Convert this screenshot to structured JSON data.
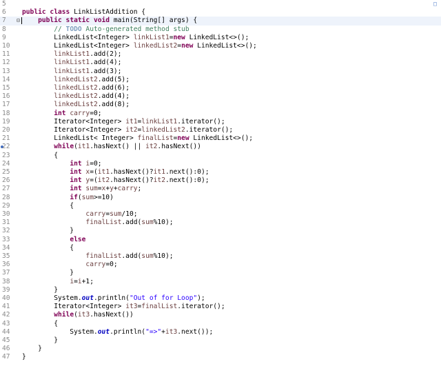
{
  "editor": {
    "lines": [
      {
        "n": "5",
        "marker": "",
        "tokens": []
      },
      {
        "n": "6",
        "marker": "",
        "tokens": [
          {
            "t": "kw",
            "v": "public class "
          },
          {
            "t": "",
            "v": "LinkListAddition {"
          }
        ]
      },
      {
        "n": "7",
        "marker": "fold",
        "tokens": [
          {
            "t": "",
            "v": "    "
          },
          {
            "t": "kw",
            "v": "public static void "
          },
          {
            "t": "",
            "v": "main(String[] args) {"
          }
        ]
      },
      {
        "n": "8",
        "marker": "",
        "tokens": [
          {
            "t": "",
            "v": "        "
          },
          {
            "t": "cm",
            "v": "// "
          },
          {
            "t": "todo",
            "v": "TODO"
          },
          {
            "t": "cm",
            "v": " Auto-generated method stub"
          }
        ]
      },
      {
        "n": "9",
        "marker": "",
        "tokens": [
          {
            "t": "",
            "v": "        LinkedList<Integer> "
          },
          {
            "t": "var",
            "v": "linkList1"
          },
          {
            "t": "",
            "v": "="
          },
          {
            "t": "kw",
            "v": "new "
          },
          {
            "t": "",
            "v": "LinkedList<>();"
          }
        ]
      },
      {
        "n": "10",
        "marker": "",
        "tokens": [
          {
            "t": "",
            "v": "        LinkedList<Integer> "
          },
          {
            "t": "var",
            "v": "linkedList2"
          },
          {
            "t": "",
            "v": "="
          },
          {
            "t": "kw",
            "v": "new "
          },
          {
            "t": "",
            "v": "LinkedList<>();"
          }
        ]
      },
      {
        "n": "11",
        "marker": "",
        "tokens": [
          {
            "t": "",
            "v": "        "
          },
          {
            "t": "var",
            "v": "linkList1"
          },
          {
            "t": "",
            "v": ".add(2);"
          }
        ]
      },
      {
        "n": "12",
        "marker": "",
        "tokens": [
          {
            "t": "",
            "v": "        "
          },
          {
            "t": "var",
            "v": "linkList1"
          },
          {
            "t": "",
            "v": ".add(4);"
          }
        ]
      },
      {
        "n": "13",
        "marker": "",
        "tokens": [
          {
            "t": "",
            "v": "        "
          },
          {
            "t": "var",
            "v": "linkList1"
          },
          {
            "t": "",
            "v": ".add(3);"
          }
        ]
      },
      {
        "n": "14",
        "marker": "",
        "tokens": [
          {
            "t": "",
            "v": "        "
          },
          {
            "t": "var",
            "v": "linkedList2"
          },
          {
            "t": "",
            "v": ".add(5);"
          }
        ]
      },
      {
        "n": "15",
        "marker": "",
        "tokens": [
          {
            "t": "",
            "v": "        "
          },
          {
            "t": "var",
            "v": "linkedList2"
          },
          {
            "t": "",
            "v": ".add(6);"
          }
        ]
      },
      {
        "n": "16",
        "marker": "",
        "tokens": [
          {
            "t": "",
            "v": "        "
          },
          {
            "t": "var",
            "v": "linkedList2"
          },
          {
            "t": "",
            "v": ".add(4);"
          }
        ]
      },
      {
        "n": "17",
        "marker": "",
        "tokens": [
          {
            "t": "",
            "v": "        "
          },
          {
            "t": "var",
            "v": "linkedList2"
          },
          {
            "t": "",
            "v": ".add(8);"
          }
        ]
      },
      {
        "n": "18",
        "marker": "",
        "tokens": [
          {
            "t": "",
            "v": "        "
          },
          {
            "t": "kw",
            "v": "int "
          },
          {
            "t": "var",
            "v": "carry"
          },
          {
            "t": "",
            "v": "=0;"
          }
        ]
      },
      {
        "n": "19",
        "marker": "",
        "tokens": [
          {
            "t": "",
            "v": "        Iterator<Integer> "
          },
          {
            "t": "var",
            "v": "it1"
          },
          {
            "t": "",
            "v": "="
          },
          {
            "t": "var",
            "v": "linkList1"
          },
          {
            "t": "",
            "v": ".iterator();"
          }
        ]
      },
      {
        "n": "20",
        "marker": "",
        "tokens": [
          {
            "t": "",
            "v": "        Iterator<Integer> "
          },
          {
            "t": "var",
            "v": "it2"
          },
          {
            "t": "",
            "v": "="
          },
          {
            "t": "var",
            "v": "linkedList2"
          },
          {
            "t": "",
            "v": ".iterator();"
          }
        ]
      },
      {
        "n": "21",
        "marker": "",
        "tokens": [
          {
            "t": "",
            "v": "        LinkedList< Integer> "
          },
          {
            "t": "var",
            "v": "finalList"
          },
          {
            "t": "",
            "v": "="
          },
          {
            "t": "kw",
            "v": "new "
          },
          {
            "t": "",
            "v": "LinkedList<>();"
          }
        ]
      },
      {
        "n": "22",
        "marker": "break",
        "tokens": [
          {
            "t": "",
            "v": "        "
          },
          {
            "t": "kw",
            "v": "while"
          },
          {
            "t": "",
            "v": "("
          },
          {
            "t": "var",
            "v": "it1"
          },
          {
            "t": "",
            "v": ".hasNext() || "
          },
          {
            "t": "var",
            "v": "it2"
          },
          {
            "t": "",
            "v": ".hasNext())"
          }
        ]
      },
      {
        "n": "23",
        "marker": "",
        "tokens": [
          {
            "t": "",
            "v": "        {"
          }
        ]
      },
      {
        "n": "24",
        "marker": "",
        "tokens": [
          {
            "t": "",
            "v": "            "
          },
          {
            "t": "kw",
            "v": "int "
          },
          {
            "t": "var",
            "v": "i"
          },
          {
            "t": "",
            "v": "=0;"
          }
        ]
      },
      {
        "n": "25",
        "marker": "",
        "tokens": [
          {
            "t": "",
            "v": "            "
          },
          {
            "t": "kw",
            "v": "int "
          },
          {
            "t": "var",
            "v": "x"
          },
          {
            "t": "",
            "v": "=("
          },
          {
            "t": "var",
            "v": "it1"
          },
          {
            "t": "",
            "v": ".hasNext()?"
          },
          {
            "t": "var",
            "v": "it1"
          },
          {
            "t": "",
            "v": ".next():0);"
          }
        ]
      },
      {
        "n": "26",
        "marker": "",
        "tokens": [
          {
            "t": "",
            "v": "            "
          },
          {
            "t": "kw",
            "v": "int "
          },
          {
            "t": "var",
            "v": "y"
          },
          {
            "t": "",
            "v": "=("
          },
          {
            "t": "var",
            "v": "it2"
          },
          {
            "t": "",
            "v": ".hasNext()?"
          },
          {
            "t": "var",
            "v": "it2"
          },
          {
            "t": "",
            "v": ".next():0);"
          }
        ]
      },
      {
        "n": "27",
        "marker": "",
        "tokens": [
          {
            "t": "",
            "v": "            "
          },
          {
            "t": "kw",
            "v": "int "
          },
          {
            "t": "var",
            "v": "sum"
          },
          {
            "t": "",
            "v": "="
          },
          {
            "t": "var",
            "v": "x"
          },
          {
            "t": "",
            "v": "+"
          },
          {
            "t": "var",
            "v": "y"
          },
          {
            "t": "",
            "v": "+"
          },
          {
            "t": "var",
            "v": "carry"
          },
          {
            "t": "",
            "v": ";"
          }
        ]
      },
      {
        "n": "28",
        "marker": "",
        "tokens": [
          {
            "t": "",
            "v": "            "
          },
          {
            "t": "kw",
            "v": "if"
          },
          {
            "t": "",
            "v": "("
          },
          {
            "t": "var",
            "v": "sum"
          },
          {
            "t": "",
            "v": ">=10)"
          }
        ]
      },
      {
        "n": "29",
        "marker": "",
        "tokens": [
          {
            "t": "",
            "v": "            {"
          }
        ]
      },
      {
        "n": "30",
        "marker": "",
        "tokens": [
          {
            "t": "",
            "v": "                "
          },
          {
            "t": "var",
            "v": "carry"
          },
          {
            "t": "",
            "v": "="
          },
          {
            "t": "var",
            "v": "sum"
          },
          {
            "t": "",
            "v": "/10;"
          }
        ]
      },
      {
        "n": "31",
        "marker": "",
        "tokens": [
          {
            "t": "",
            "v": "                "
          },
          {
            "t": "var",
            "v": "finalList"
          },
          {
            "t": "",
            "v": ".add("
          },
          {
            "t": "var",
            "v": "sum"
          },
          {
            "t": "",
            "v": "%10);"
          }
        ]
      },
      {
        "n": "32",
        "marker": "",
        "tokens": [
          {
            "t": "",
            "v": "            }"
          }
        ]
      },
      {
        "n": "33",
        "marker": "",
        "tokens": [
          {
            "t": "",
            "v": "            "
          },
          {
            "t": "kw",
            "v": "else"
          }
        ]
      },
      {
        "n": "34",
        "marker": "",
        "tokens": [
          {
            "t": "",
            "v": "            {"
          }
        ]
      },
      {
        "n": "35",
        "marker": "",
        "tokens": [
          {
            "t": "",
            "v": "                "
          },
          {
            "t": "var",
            "v": "finalList"
          },
          {
            "t": "",
            "v": ".add("
          },
          {
            "t": "var",
            "v": "sum"
          },
          {
            "t": "",
            "v": "%10);"
          }
        ]
      },
      {
        "n": "36",
        "marker": "",
        "tokens": [
          {
            "t": "",
            "v": "                "
          },
          {
            "t": "var",
            "v": "carry"
          },
          {
            "t": "",
            "v": "=0;"
          }
        ]
      },
      {
        "n": "37",
        "marker": "",
        "tokens": [
          {
            "t": "",
            "v": "            }"
          }
        ]
      },
      {
        "n": "38",
        "marker": "",
        "tokens": [
          {
            "t": "",
            "v": "            "
          },
          {
            "t": "var",
            "v": "i"
          },
          {
            "t": "",
            "v": "="
          },
          {
            "t": "var",
            "v": "i"
          },
          {
            "t": "",
            "v": "+1;"
          }
        ]
      },
      {
        "n": "39",
        "marker": "",
        "tokens": [
          {
            "t": "",
            "v": "        }"
          }
        ]
      },
      {
        "n": "40",
        "marker": "",
        "tokens": [
          {
            "t": "",
            "v": "        System."
          },
          {
            "t": "fld",
            "v": "out"
          },
          {
            "t": "",
            "v": ".println("
          },
          {
            "t": "str",
            "v": "\"Out of for Loop\""
          },
          {
            "t": "",
            "v": ");"
          }
        ]
      },
      {
        "n": "41",
        "marker": "",
        "tokens": [
          {
            "t": "",
            "v": "        Iterator<Integer> "
          },
          {
            "t": "var",
            "v": "it3"
          },
          {
            "t": "",
            "v": "="
          },
          {
            "t": "var",
            "v": "finalList"
          },
          {
            "t": "",
            "v": ".iterator();"
          }
        ]
      },
      {
        "n": "42",
        "marker": "",
        "tokens": [
          {
            "t": "",
            "v": "        "
          },
          {
            "t": "kw",
            "v": "while"
          },
          {
            "t": "",
            "v": "("
          },
          {
            "t": "var",
            "v": "it3"
          },
          {
            "t": "",
            "v": ".hasNext())"
          }
        ]
      },
      {
        "n": "43",
        "marker": "",
        "tokens": [
          {
            "t": "",
            "v": "        {"
          }
        ]
      },
      {
        "n": "44",
        "marker": "",
        "tokens": [
          {
            "t": "",
            "v": "            System."
          },
          {
            "t": "fld",
            "v": "out"
          },
          {
            "t": "",
            "v": ".println("
          },
          {
            "t": "str",
            "v": "\"=>\""
          },
          {
            "t": "",
            "v": "+"
          },
          {
            "t": "var",
            "v": "it3"
          },
          {
            "t": "",
            "v": ".next());"
          }
        ]
      },
      {
        "n": "45",
        "marker": "",
        "tokens": [
          {
            "t": "",
            "v": "        }"
          }
        ]
      },
      {
        "n": "46",
        "marker": "",
        "tokens": [
          {
            "t": "",
            "v": "    }"
          }
        ]
      },
      {
        "n": "47",
        "marker": "",
        "tokens": [
          {
            "t": "",
            "v": "}"
          }
        ]
      }
    ],
    "current_line": "7",
    "colors": {
      "keyword": "#7f0055",
      "comment": "#3f7f5f",
      "todo": "#7f9fbf",
      "local_variable": "#6a3e3e",
      "static_field": "#0000c0",
      "string": "#2a00ff",
      "line_number": "#8a8a8a",
      "current_line_bg": "#eef3fb"
    }
  }
}
